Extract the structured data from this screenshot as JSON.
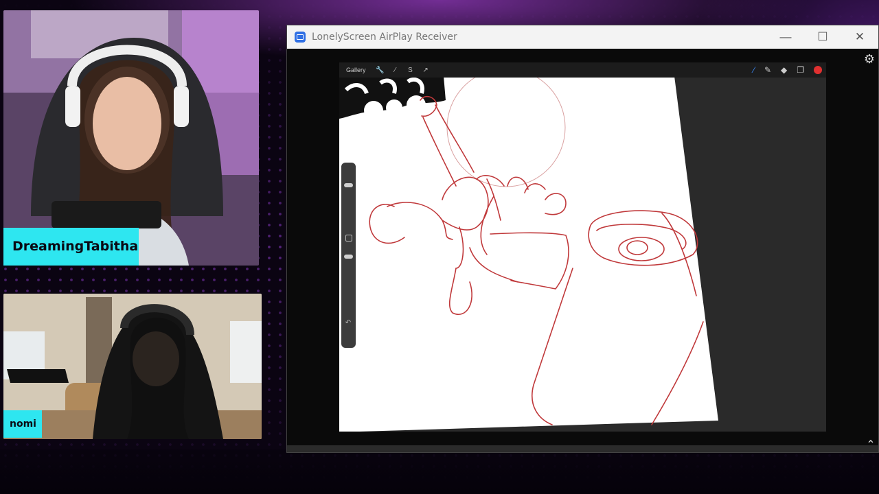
{
  "stream": {
    "host_name": "DreamingTabitha",
    "guest_name": "nomi",
    "accent_color": "#2ee6f0"
  },
  "window": {
    "title": "LonelyScreen AirPlay Receiver",
    "minimize_glyph": "—",
    "maximize_glyph": "☐",
    "close_glyph": "✕",
    "settings_icon": "gear-icon",
    "scroll_icon": "chevron-up-icon"
  },
  "procreate": {
    "gallery_label": "Gallery",
    "left_tools": [
      "wrench-icon",
      "wand-icon",
      "selection-icon",
      "transform-icon"
    ],
    "right_tools": [
      "brush-icon",
      "smudge-icon",
      "eraser-icon",
      "layers-icon"
    ],
    "active_color": "#e03030",
    "stroke_color": "#c0393b"
  }
}
